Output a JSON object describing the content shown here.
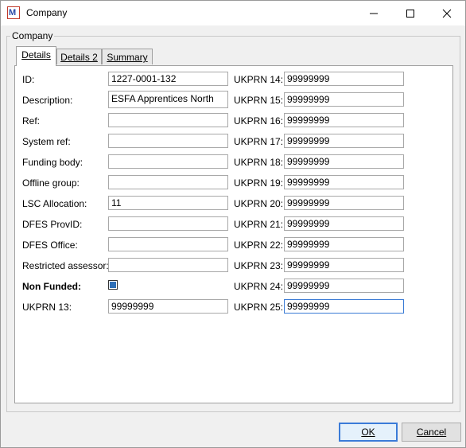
{
  "window": {
    "title": "Company",
    "app_icon_letter": "M"
  },
  "group": {
    "label": "Company"
  },
  "tabs": [
    {
      "label": "Details",
      "active": true
    },
    {
      "label": "Details 2",
      "active": false
    },
    {
      "label": "Summary",
      "active": false
    }
  ],
  "left_fields": [
    {
      "label": "ID:",
      "value": "1227-0001-132"
    },
    {
      "label": "Description:",
      "value": "ESFA Apprentices North"
    },
    {
      "label": "Ref:",
      "value": ""
    },
    {
      "label": "System ref:",
      "value": ""
    },
    {
      "label": "Funding body:",
      "value": ""
    },
    {
      "label": "Offline group:",
      "value": ""
    },
    {
      "label": "LSC Allocation:",
      "value": "11"
    },
    {
      "label": "DFES ProvID:",
      "value": ""
    },
    {
      "label": "DFES Office:",
      "value": ""
    },
    {
      "label": "Restricted assessor:",
      "value": ""
    }
  ],
  "non_funded": {
    "label": "Non Funded:",
    "checked": true
  },
  "ukprn13": {
    "label": "UKPRN 13:",
    "value": "99999999"
  },
  "right_fields": [
    {
      "label": "UKPRN 14:",
      "value": "99999999"
    },
    {
      "label": "UKPRN 15:",
      "value": "99999999"
    },
    {
      "label": "UKPRN 16:",
      "value": "99999999"
    },
    {
      "label": "UKPRN 17:",
      "value": "99999999"
    },
    {
      "label": "UKPRN 18:",
      "value": "99999999"
    },
    {
      "label": "UKPRN 19:",
      "value": "99999999"
    },
    {
      "label": "UKPRN 20:",
      "value": "99999999"
    },
    {
      "label": "UKPRN 21:",
      "value": "99999999"
    },
    {
      "label": "UKPRN 22:",
      "value": "99999999"
    },
    {
      "label": "UKPRN 23:",
      "value": "99999999"
    },
    {
      "label": "UKPRN 24:",
      "value": "99999999"
    },
    {
      "label": "UKPRN 25:",
      "value": "99999999"
    }
  ],
  "buttons": {
    "ok": "OK",
    "cancel": "Cancel"
  },
  "colors": {
    "accent": "#3b7bd8",
    "checkbox_fill": "#2e6fb7"
  }
}
